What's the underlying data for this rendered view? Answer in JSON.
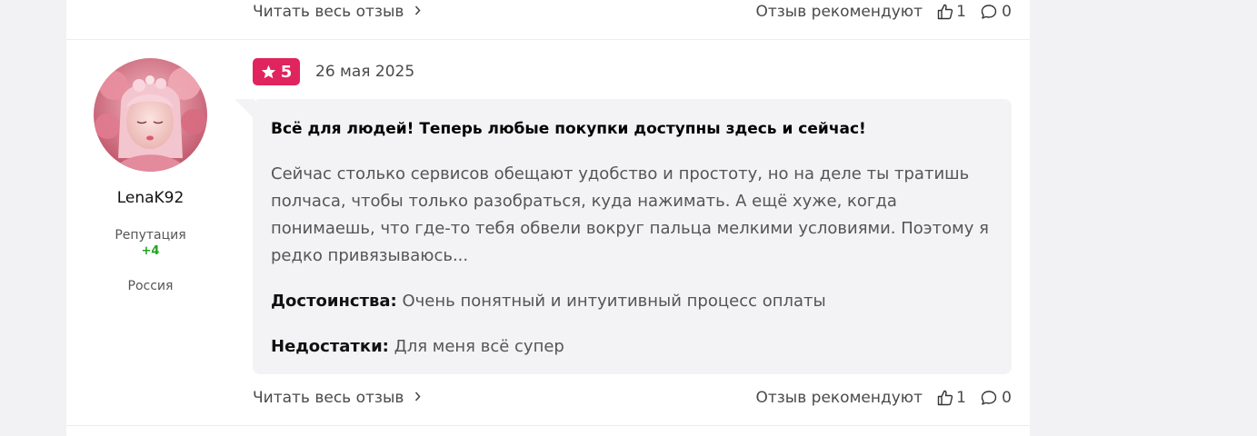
{
  "previous_review_footer": {
    "read_more": "Читать весь отзыв",
    "recommend": "Отзыв рекомендуют",
    "likes": "1",
    "comments": "0"
  },
  "author": {
    "username": "LenaK92",
    "reputation_label": "Репутация",
    "reputation_value": "+4",
    "country": "Россия",
    "avatar_icon": "doll-avatar-icon"
  },
  "review": {
    "rating": "5",
    "date": "26 мая 2025",
    "title": "Всё для людей! Теперь любые покупки доступны здесь и сейчас!",
    "body": "Сейчас столько сервисов обещают удобство и простоту, но на деле ты тратишь полчаса, чтобы только разобраться, куда нажимать. А ещё хуже, когда понимаешь, что где-то тебя обвели вокруг пальца мелкими условиями. Поэтому я редко привязываюсь...",
    "pros_label": "Достоинства:",
    "pros_text": "Очень понятный и интуитивный процесс оплаты",
    "cons_label": "Недостатки:",
    "cons_text": "Для меня всё супер"
  },
  "footer": {
    "read_more": "Читать весь отзыв",
    "recommend": "Отзыв рекомендуют",
    "likes": "1",
    "comments": "0"
  },
  "colors": {
    "rating_badge": "#e0245e",
    "reputation_positive": "#1ea51e",
    "bubble_background": "#f3f3f5",
    "page_background": "#f2f2f4"
  }
}
